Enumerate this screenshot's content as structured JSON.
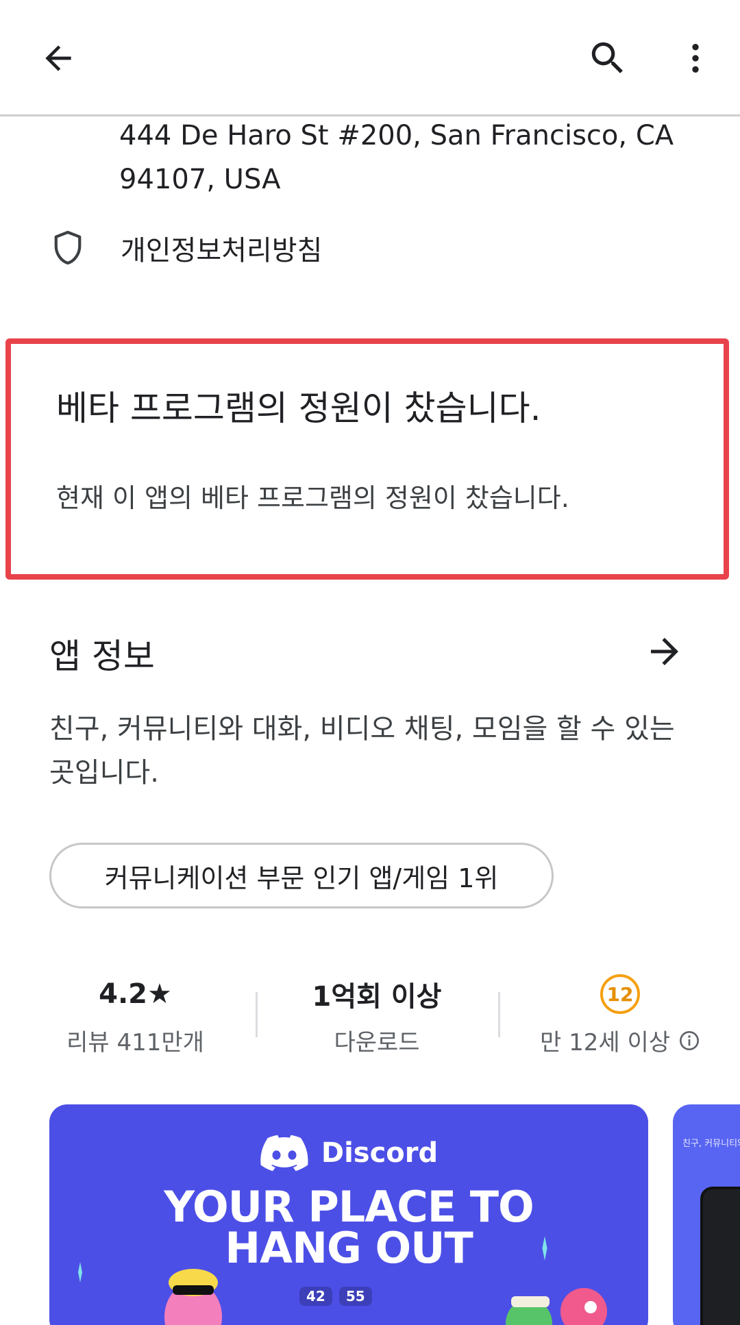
{
  "topbar": {
    "back_icon": "arrow-left-icon",
    "search_icon": "search-icon",
    "more_icon": "more-vert-icon"
  },
  "developer": {
    "address": "444 De Haro St #200, San Francisco, CA 94107, USA",
    "privacy_label": "개인정보처리방침",
    "privacy_icon": "shield-icon"
  },
  "beta": {
    "title": "베타 프로그램의 정원이 찼습니다.",
    "description": "현재 이 앱의 베타 프로그램의 정원이 찼습니다.",
    "highlight_color": "#e8434b"
  },
  "app_info": {
    "title": "앱 정보",
    "description": "친구, 커뮤니티와 대화, 비디오 채팅, 모임을 할 수 있는 곳입니다.",
    "chip": "커뮤니케이션 부문 인기 앱/게임 1위"
  },
  "stats": {
    "rating": "4.2★",
    "reviews": "리뷰 411만개",
    "downloads": "1억회 이상",
    "downloads_label": "다운로드",
    "age_badge": "12",
    "age_label": "만 12세 이상",
    "age_color": "#f5a00f"
  },
  "screenshots": {
    "brand": "Discord",
    "headline_line1": "YOUR PLACE TO",
    "headline_line2": "HANG OUT",
    "count_a": "42",
    "count_b": "55",
    "second_caption": "친구, 커뮤니티와 대화",
    "brand_color": "#5865f2"
  }
}
